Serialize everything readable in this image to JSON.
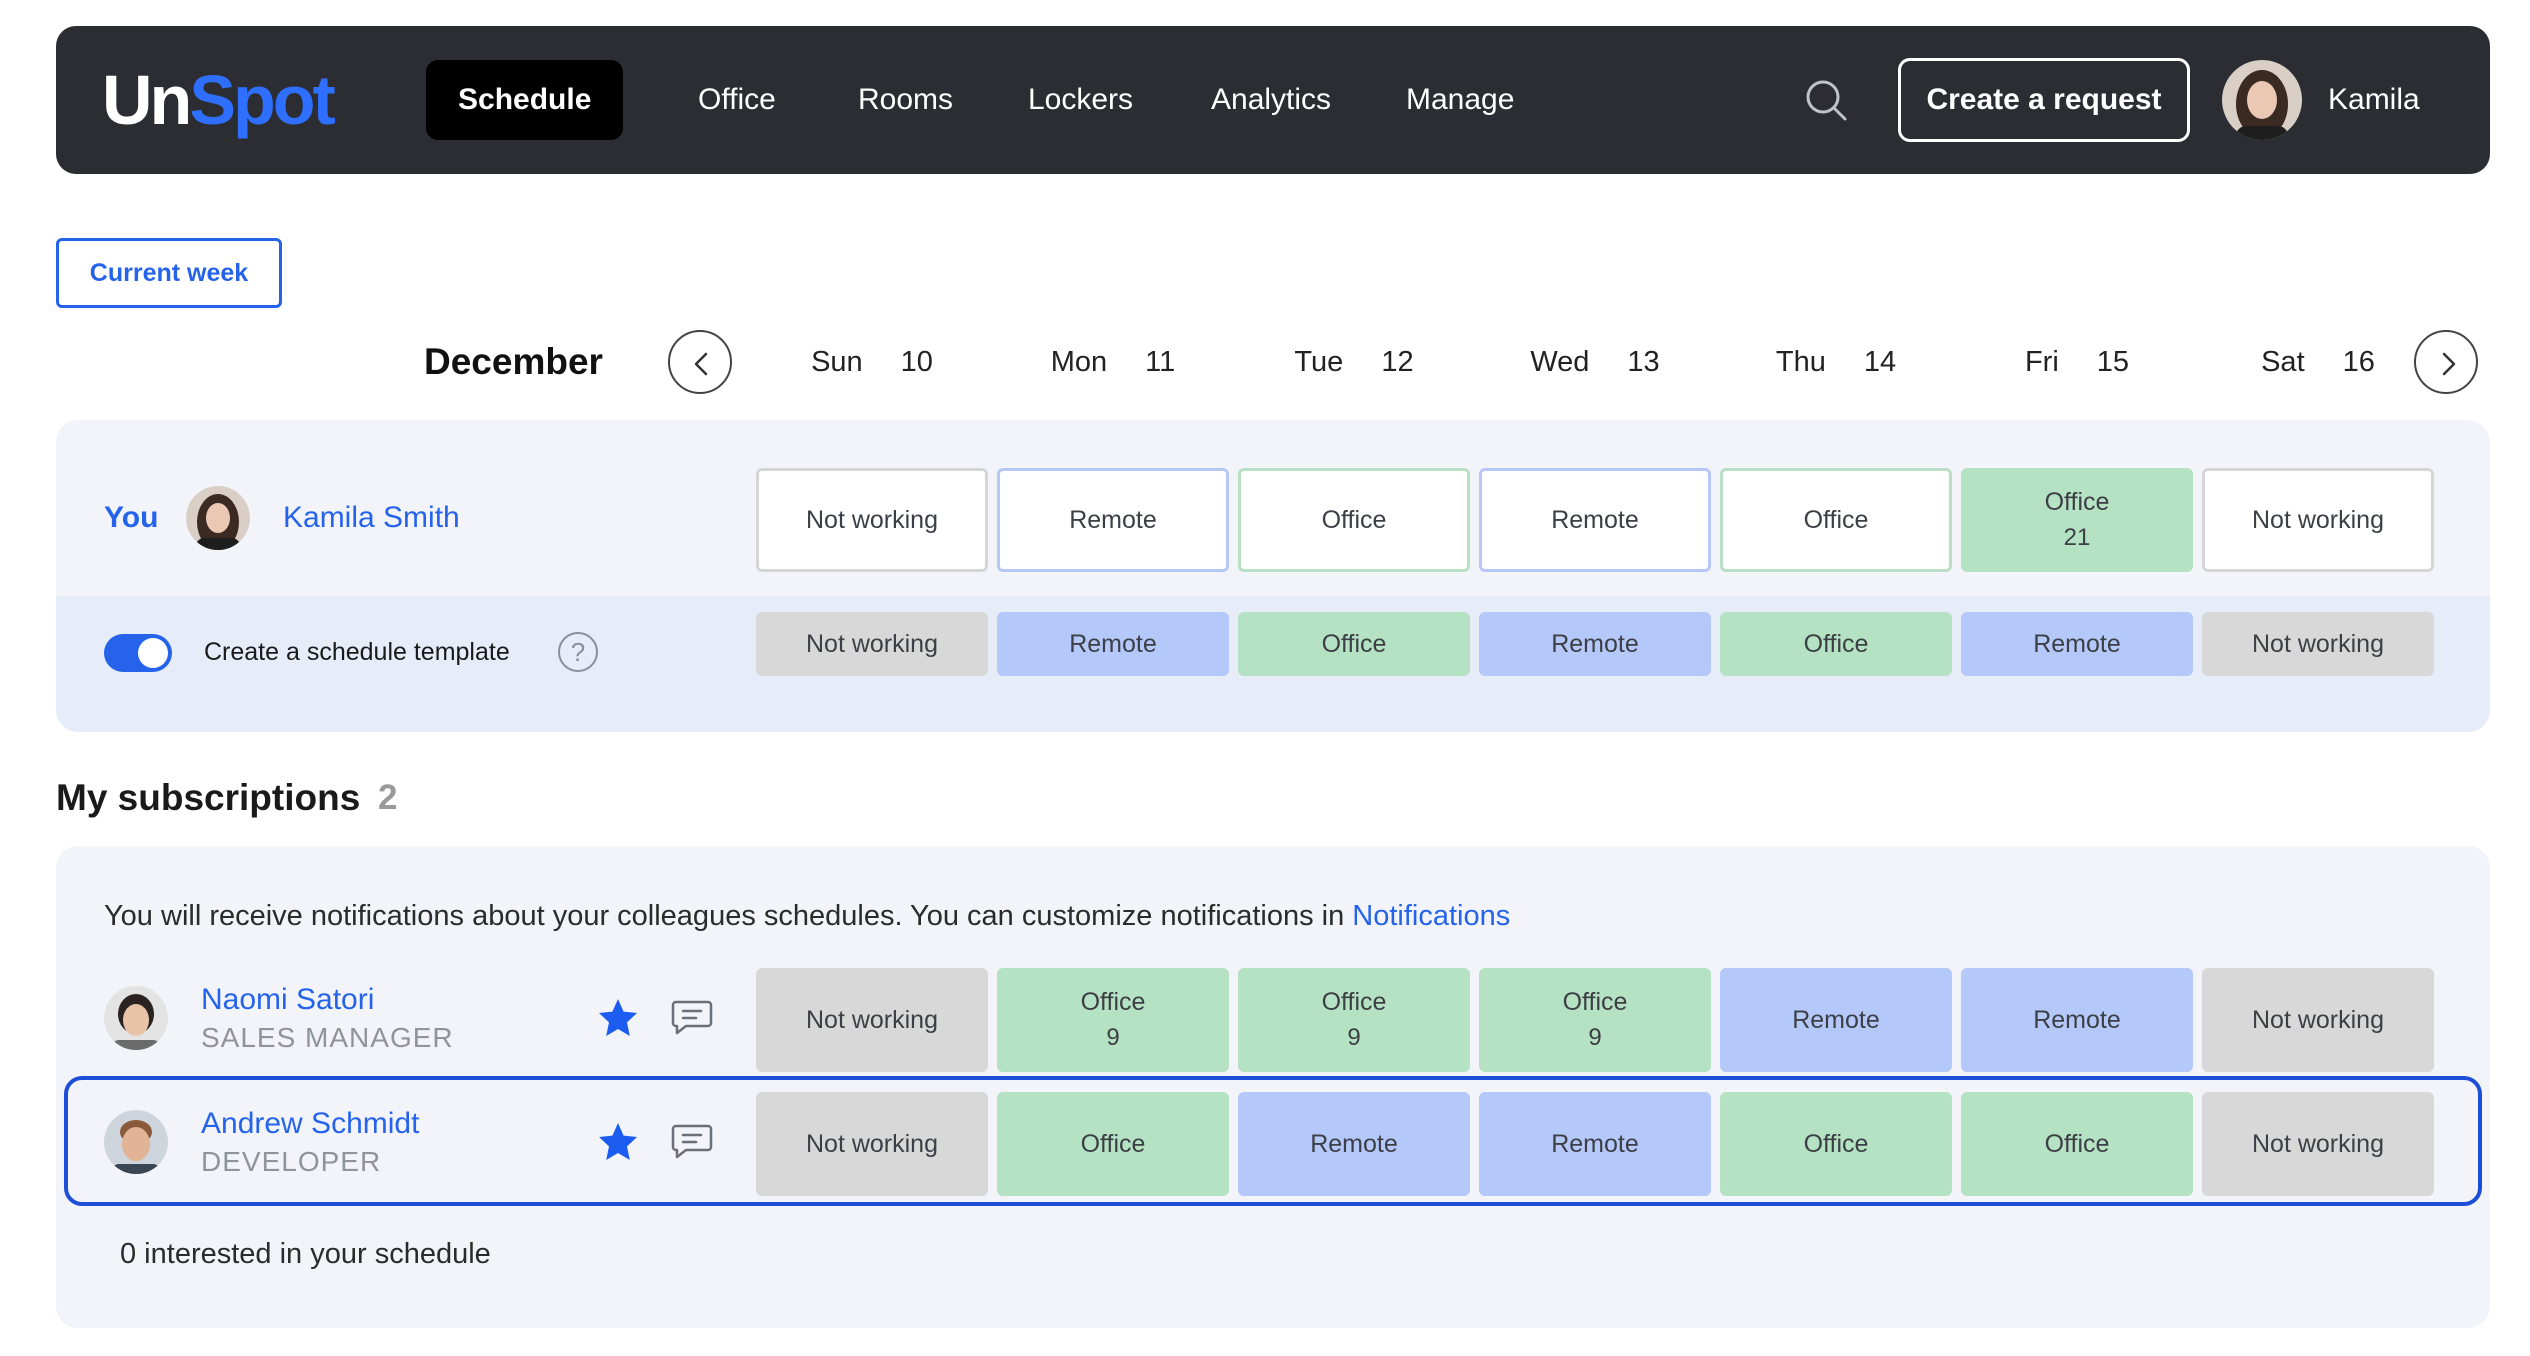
{
  "header": {
    "logo_part1": "Un",
    "logo_part2": "Spot",
    "nav": [
      "Schedule",
      "Office",
      "Rooms",
      "Lockers",
      "Analytics",
      "Manage"
    ],
    "active_nav": "Schedule",
    "create_request_label": "Create a request",
    "user_name": "Kamila"
  },
  "week": {
    "current_week_label": "Current week",
    "month": "December",
    "days": [
      {
        "name": "Sun",
        "num": "10"
      },
      {
        "name": "Mon",
        "num": "11"
      },
      {
        "name": "Tue",
        "num": "12"
      },
      {
        "name": "Wed",
        "num": "13"
      },
      {
        "name": "Thu",
        "num": "14"
      },
      {
        "name": "Fri",
        "num": "15"
      },
      {
        "name": "Sat",
        "num": "16"
      }
    ]
  },
  "you": {
    "label": "You",
    "name": "Kamila Smith",
    "schedule": [
      {
        "status": "Not working",
        "type": "not-working",
        "detail": ""
      },
      {
        "status": "Remote",
        "type": "remote",
        "detail": ""
      },
      {
        "status": "Office",
        "type": "office",
        "detail": ""
      },
      {
        "status": "Remote",
        "type": "remote",
        "detail": ""
      },
      {
        "status": "Office",
        "type": "office",
        "detail": ""
      },
      {
        "status": "Office",
        "type": "office",
        "detail": "21",
        "filled": true
      },
      {
        "status": "Not working",
        "type": "not-working",
        "detail": ""
      }
    ]
  },
  "template": {
    "enabled": true,
    "label": "Create a schedule template",
    "help": "?",
    "schedule": [
      {
        "status": "Not working",
        "type": "not-working"
      },
      {
        "status": "Remote",
        "type": "remote"
      },
      {
        "status": "Office",
        "type": "office"
      },
      {
        "status": "Remote",
        "type": "remote"
      },
      {
        "status": "Office",
        "type": "office"
      },
      {
        "status": "Remote",
        "type": "remote"
      },
      {
        "status": "Not working",
        "type": "not-working"
      }
    ]
  },
  "subscriptions": {
    "title": "My subscriptions",
    "count": "2",
    "notice_text": "You will receive notifications about your colleagues schedules. You can customize notifications in ",
    "notice_link": "Notifications",
    "people": [
      {
        "name": "Naomi Satori",
        "role": "SALES MANAGER",
        "starred": true,
        "schedule": [
          {
            "status": "Not working",
            "type": "not-working",
            "detail": ""
          },
          {
            "status": "Office",
            "type": "office",
            "detail": "9"
          },
          {
            "status": "Office",
            "type": "office",
            "detail": "9"
          },
          {
            "status": "Office",
            "type": "office",
            "detail": "9"
          },
          {
            "status": "Remote",
            "type": "remote",
            "detail": ""
          },
          {
            "status": "Remote",
            "type": "remote",
            "detail": ""
          },
          {
            "status": "Not working",
            "type": "not-working",
            "detail": ""
          }
        ]
      },
      {
        "name": "Andrew Schmidt",
        "role": "DEVELOPER",
        "starred": true,
        "highlighted": true,
        "schedule": [
          {
            "status": "Not working",
            "type": "not-working",
            "detail": ""
          },
          {
            "status": "Office",
            "type": "office",
            "detail": ""
          },
          {
            "status": "Remote",
            "type": "remote",
            "detail": ""
          },
          {
            "status": "Remote",
            "type": "remote",
            "detail": ""
          },
          {
            "status": "Office",
            "type": "office",
            "detail": ""
          },
          {
            "status": "Office",
            "type": "office",
            "detail": ""
          },
          {
            "status": "Not working",
            "type": "not-working",
            "detail": ""
          }
        ]
      }
    ],
    "interested_text": "0 interested in your schedule"
  },
  "colors": {
    "navbar": "#2b2d33",
    "accent": "#2563eb",
    "not_working": "#d8d8d8",
    "remote": "#b5c8fa",
    "office": "#b6e2c4",
    "panel": "#f2f4fa"
  }
}
